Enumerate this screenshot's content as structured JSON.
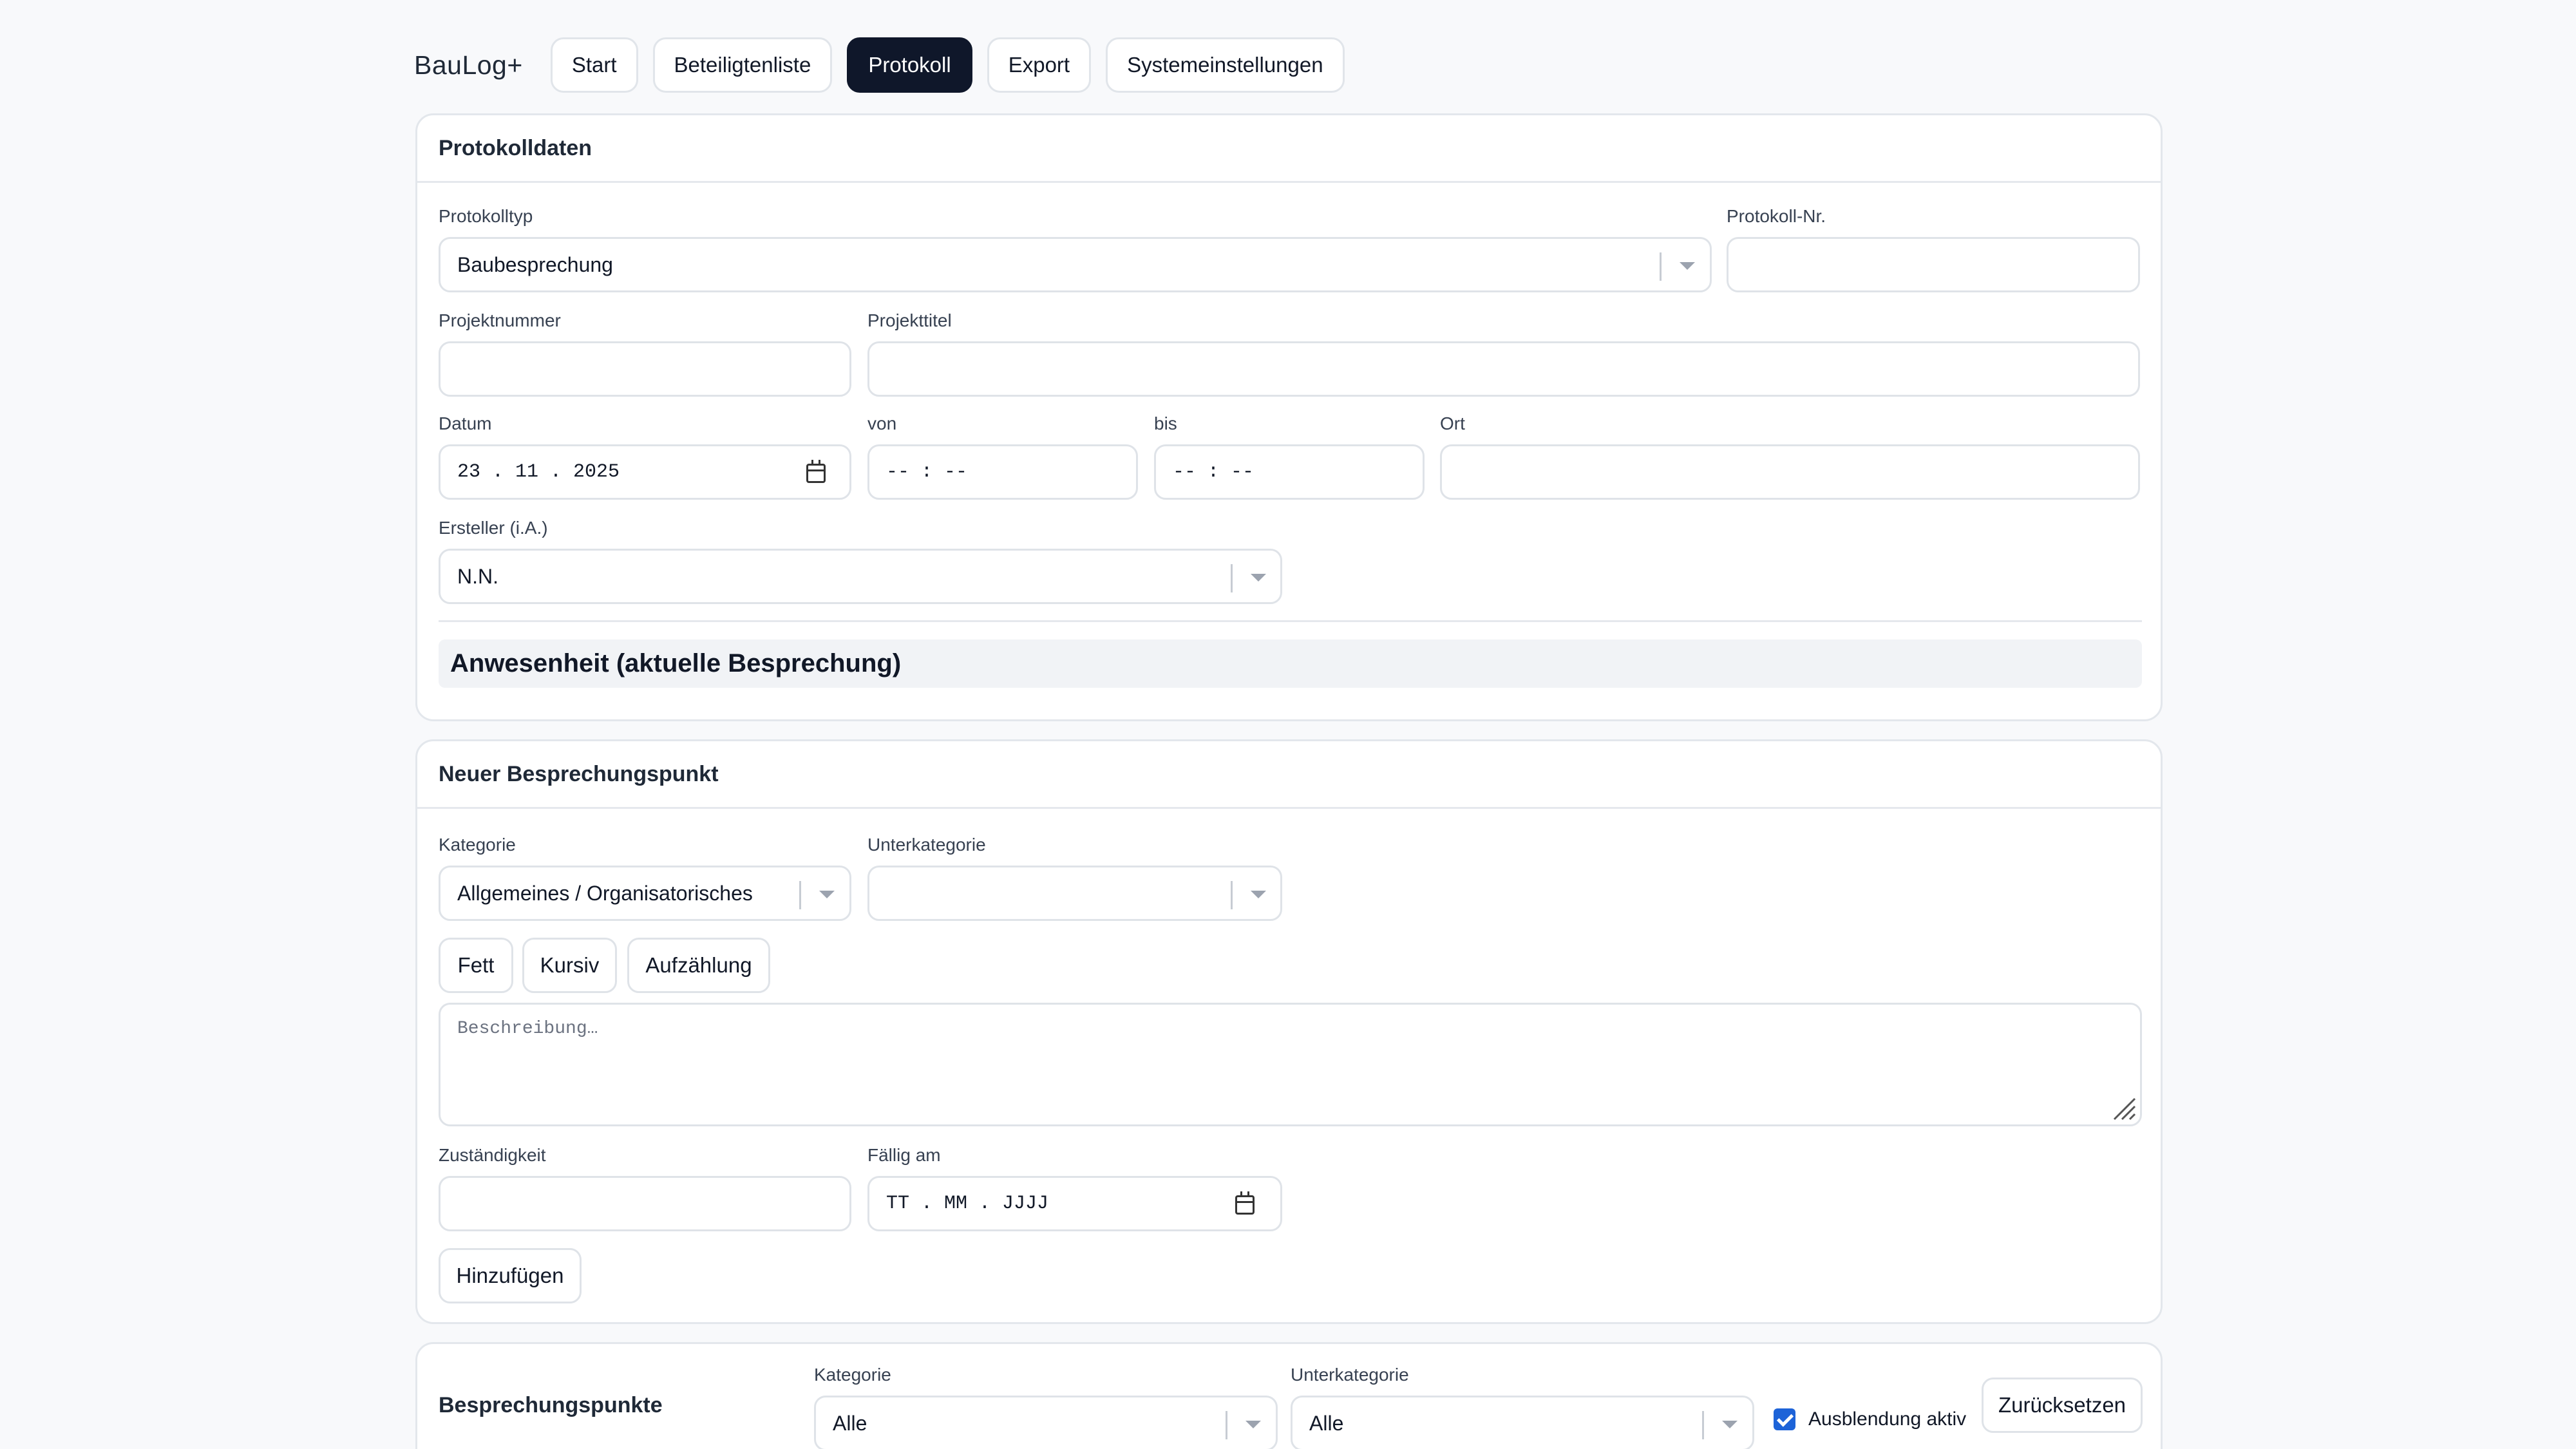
{
  "app": {
    "brand": "BauLog+"
  },
  "nav": {
    "tabs": [
      {
        "label": "Start",
        "active": false
      },
      {
        "label": "Beteiligtenliste",
        "active": false
      },
      {
        "label": "Protokoll",
        "active": true
      },
      {
        "label": "Export",
        "active": false
      },
      {
        "label": "Systemeinstellungen",
        "active": false
      }
    ]
  },
  "protokolldaten": {
    "title": "Protokolldaten",
    "protokolltyp": {
      "label": "Protokolltyp",
      "value": "Baubesprechung"
    },
    "protokoll_nr": {
      "label": "Protokoll-Nr.",
      "value": ""
    },
    "projektnummer": {
      "label": "Projektnummer",
      "value": ""
    },
    "projekttitel": {
      "label": "Projekttitel",
      "value": ""
    },
    "datum": {
      "label": "Datum",
      "value": "23 . 11 . 2025"
    },
    "von": {
      "label": "von",
      "value": "-- : --"
    },
    "bis": {
      "label": "bis",
      "value": "-- : --"
    },
    "ort": {
      "label": "Ort",
      "value": ""
    },
    "ersteller": {
      "label": "Ersteller (i.A.)",
      "value": "N.N."
    },
    "anwesenheit_title": "Anwesenheit (aktuelle Besprechung)"
  },
  "neuer_punkt": {
    "title": "Neuer Besprechungspunkt",
    "kategorie": {
      "label": "Kategorie",
      "value": "Allgemeines / Organisatorisches"
    },
    "unterkategorie": {
      "label": "Unterkategorie",
      "value": ""
    },
    "format_buttons": {
      "bold": "Fett",
      "italic": "Kursiv",
      "list": "Aufzählung"
    },
    "beschreibung_placeholder": "Beschreibung…",
    "zustaendigkeit": {
      "label": "Zuständigkeit",
      "value": ""
    },
    "faellig": {
      "label": "Fällig am",
      "value": "TT . MM . JJJJ"
    },
    "add_button": "Hinzufügen"
  },
  "punkte": {
    "title": "Besprechungspunkte",
    "kategorie": {
      "label": "Kategorie",
      "value": "Alle"
    },
    "unterkategorie": {
      "label": "Unterkategorie",
      "value": "Alle"
    },
    "ausblendung": {
      "label": "Ausblendung aktiv",
      "checked": true
    },
    "reset_button": "Zurücksetzen"
  },
  "colors": {
    "accent": "#0f172a",
    "checkbox": "#1d63d8",
    "background": "#f8f9fb"
  }
}
